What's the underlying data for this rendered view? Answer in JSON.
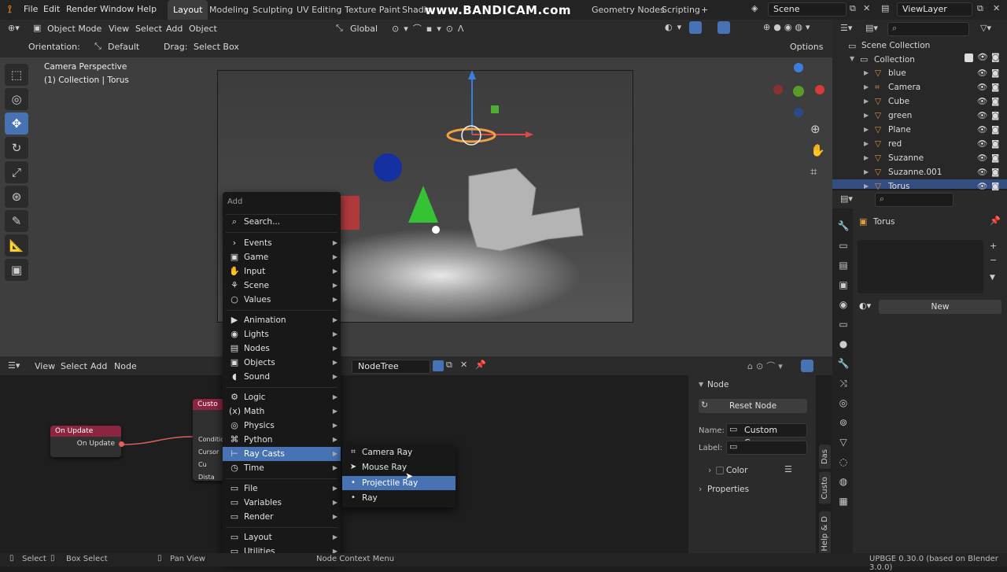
{
  "topbar": {
    "menus": [
      "File",
      "Edit",
      "Render",
      "Window",
      "Help"
    ],
    "workspaces": [
      "Layout",
      "Modeling",
      "Sculpting",
      "UV Editing",
      "Texture Paint",
      "Shadin",
      "Geometry Nodes",
      "Scripting",
      "+"
    ],
    "watermark": "www.BANDICAM.com",
    "scene": "Scene",
    "view_layer": "ViewLayer"
  },
  "viewport_header": {
    "mode": "Object Mode",
    "menus": [
      "View",
      "Select",
      "Add",
      "Object"
    ],
    "transform": "Global",
    "orientation_label": "Orientation:",
    "orientation_value": "Default",
    "drag_label": "Drag:",
    "drag_value": "Select Box",
    "options": "Options"
  },
  "viewport": {
    "camera_label": "Camera Perspective",
    "collection_label": "(1) Collection | Torus"
  },
  "outliner": {
    "root": "Scene Collection",
    "collection": "Collection",
    "items": [
      "blue",
      "Camera",
      "Cube",
      "green",
      "Plane",
      "red",
      "Suzanne",
      "Suzanne.001",
      "Torus"
    ],
    "selected": "Torus"
  },
  "properties": {
    "object_name": "Torus",
    "new_button": "New"
  },
  "node_editor": {
    "menus": [
      "View",
      "Select",
      "Add",
      "Node"
    ],
    "tree_name": "NodeTree",
    "on_update_title": "On Update",
    "on_update_socket": "On Update",
    "custom_title": "Custo",
    "custom_inputs": [
      "Condition",
      "Cursor",
      "Cu",
      "Dista"
    ]
  },
  "npanel": {
    "section": "Node",
    "reset": "Reset Node",
    "name_label": "Name:",
    "name_value": "Custom Cursor",
    "label_label": "Label:",
    "color": "Color",
    "properties": "Properties",
    "tabs": [
      "Das",
      "Custo",
      "Help & D"
    ]
  },
  "add_menu": {
    "title": "Add",
    "search": "Search...",
    "items": [
      "Events",
      "Game",
      "Input",
      "Scene",
      "Values",
      "Animation",
      "Lights",
      "Nodes",
      "Objects",
      "Sound",
      "Logic",
      "Math",
      "Physics",
      "Python",
      "Ray Casts",
      "Time",
      "File",
      "Variables",
      "Render",
      "Layout",
      "Utilities"
    ],
    "highlighted": "Ray Casts"
  },
  "submenu": {
    "items": [
      "Camera Ray",
      "Mouse Ray",
      "Projectile Ray",
      "Ray"
    ],
    "highlighted": "Projectile Ray"
  },
  "statusbar": {
    "select": "Select",
    "box_select": "Box Select",
    "pan_view": "Pan View",
    "context": "Node Context Menu",
    "version": "UPBGE 0.30.0 (based on Blender 3.0.0)"
  },
  "colors": {
    "accent": "#4772b3",
    "node_header": "#8b2540",
    "selection": "#334d80"
  }
}
